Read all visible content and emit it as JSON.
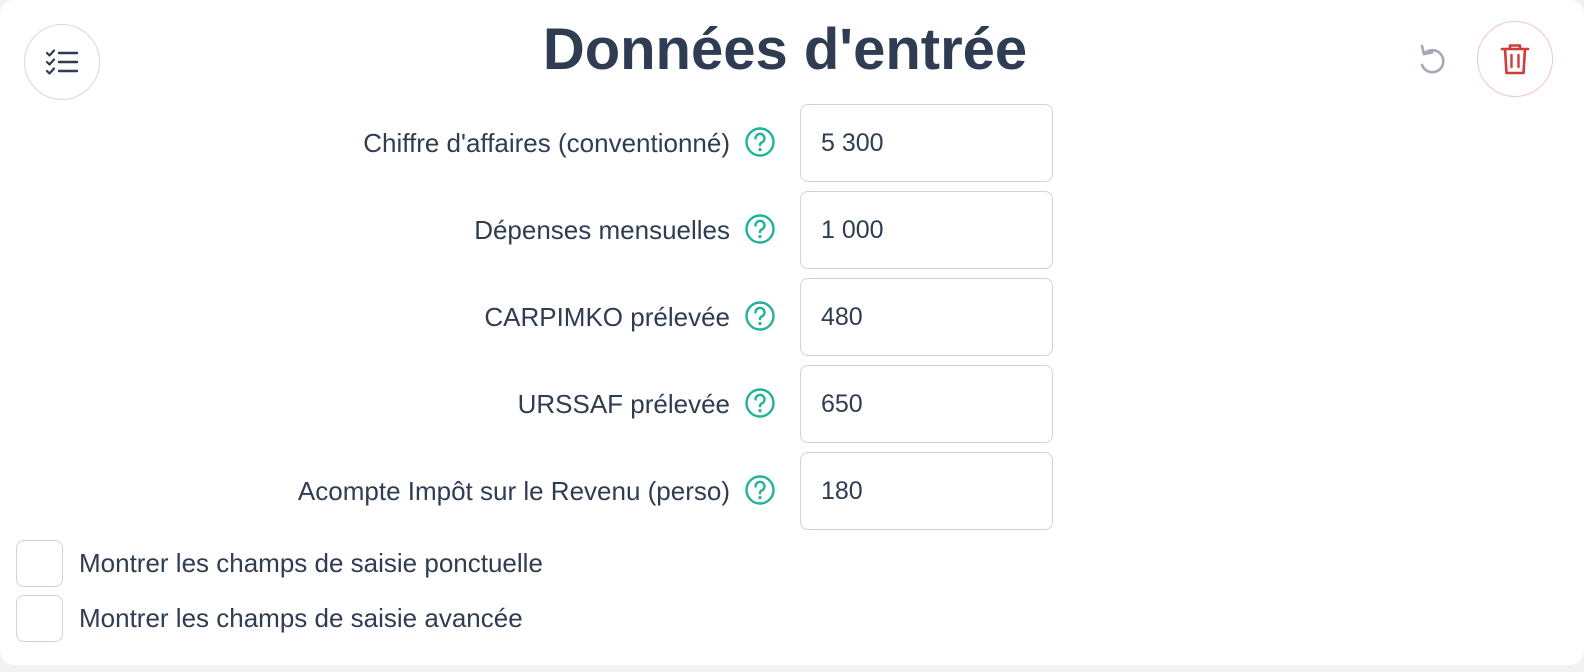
{
  "header": {
    "title": "Données d'entrée",
    "menu_icon": "checklist-icon",
    "reset_icon": "undo-icon",
    "trash_icon": "trash-icon"
  },
  "fields": [
    {
      "label": "Chiffre d'affaires (conventionné)",
      "value": "5 300"
    },
    {
      "label": "Dépenses mensuelles",
      "value": "1 000"
    },
    {
      "label": "CARPIMKO prélevée",
      "value": "480"
    },
    {
      "label": "URSSAF prélevée",
      "value": "650"
    },
    {
      "label": "Acompte Impôt sur le Revenu (perso)",
      "value": "180"
    }
  ],
  "checkboxes": [
    {
      "label": "Montrer les champs de saisie ponctuelle",
      "checked": false
    },
    {
      "label": "Montrer les champs de saisie avancée",
      "checked": false
    }
  ],
  "colors": {
    "text": "#2f3d52",
    "help_accent": "#1fb39a",
    "danger": "#d33a3a",
    "border": "#cfd4da"
  }
}
